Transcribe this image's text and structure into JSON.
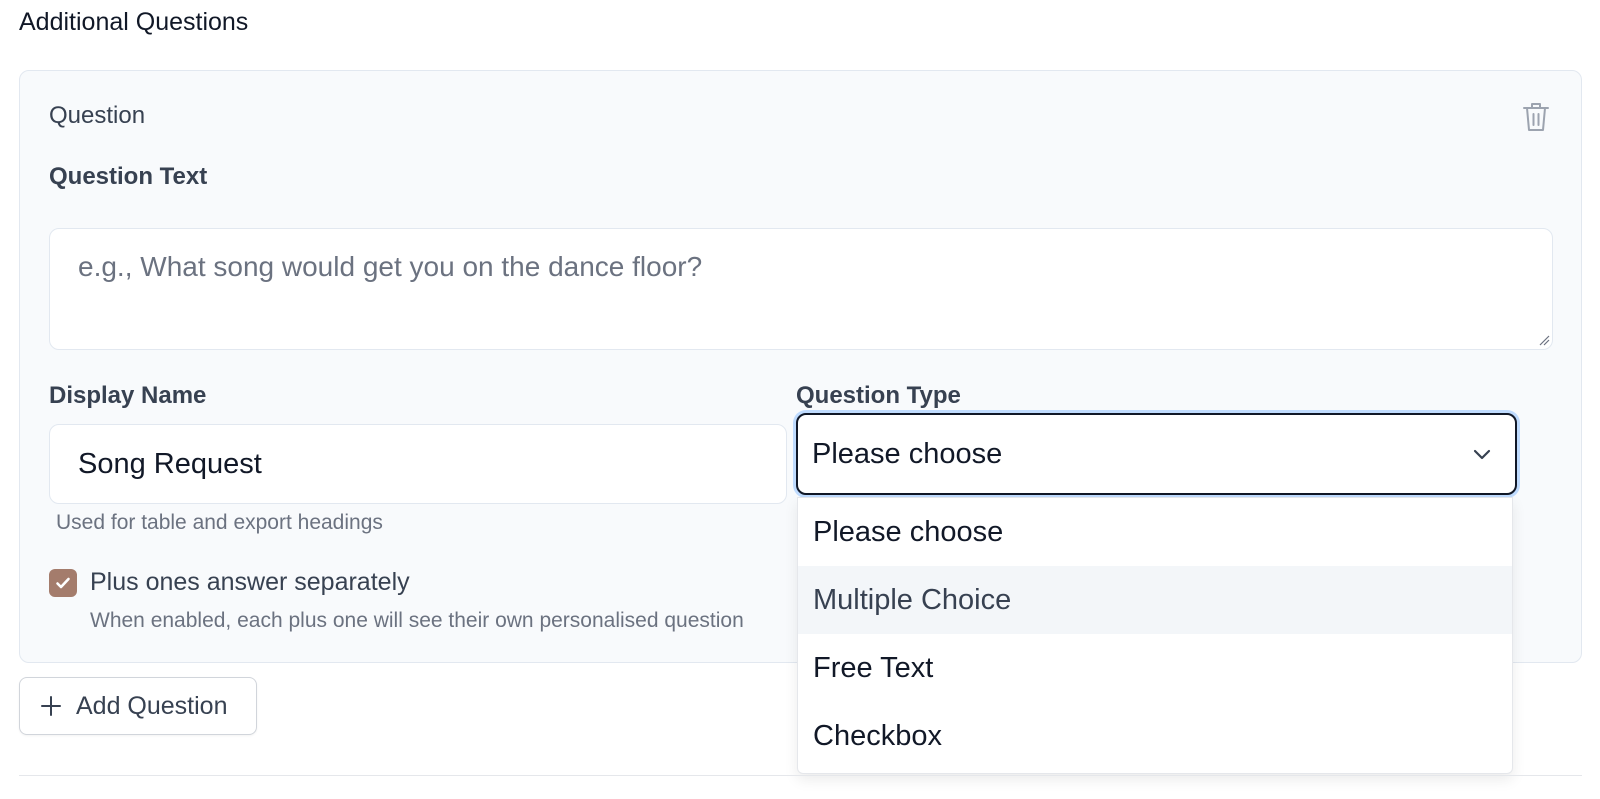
{
  "section": {
    "title": "Additional Questions"
  },
  "card": {
    "title": "Question",
    "question_text": {
      "label": "Question Text",
      "value": "",
      "placeholder": "e.g., What song would get you on the dance floor?"
    },
    "display_name": {
      "label": "Display Name",
      "value": "Song Request",
      "help": "Used for table and export headings"
    },
    "question_type": {
      "label": "Question Type",
      "selected": "Please choose",
      "options": [
        "Please choose",
        "Multiple Choice",
        "Free Text",
        "Checkbox"
      ],
      "highlighted_option": "Multiple Choice"
    },
    "plus_ones": {
      "checked": true,
      "label": "Plus ones answer separately",
      "description": "When enabled, each plus one will see their own personalised question"
    }
  },
  "actions": {
    "add_question_label": "Add Question"
  },
  "icons": {
    "delete": "trash-icon",
    "select": "chevron-down-icon",
    "checkbox": "check-icon",
    "add": "plus-icon"
  },
  "colors": {
    "card_background": "#f8fafc",
    "checkbox_accent": "#a47c6c",
    "focus_ring": "#bfdbfe",
    "option_highlight": "#f3f6f9"
  }
}
